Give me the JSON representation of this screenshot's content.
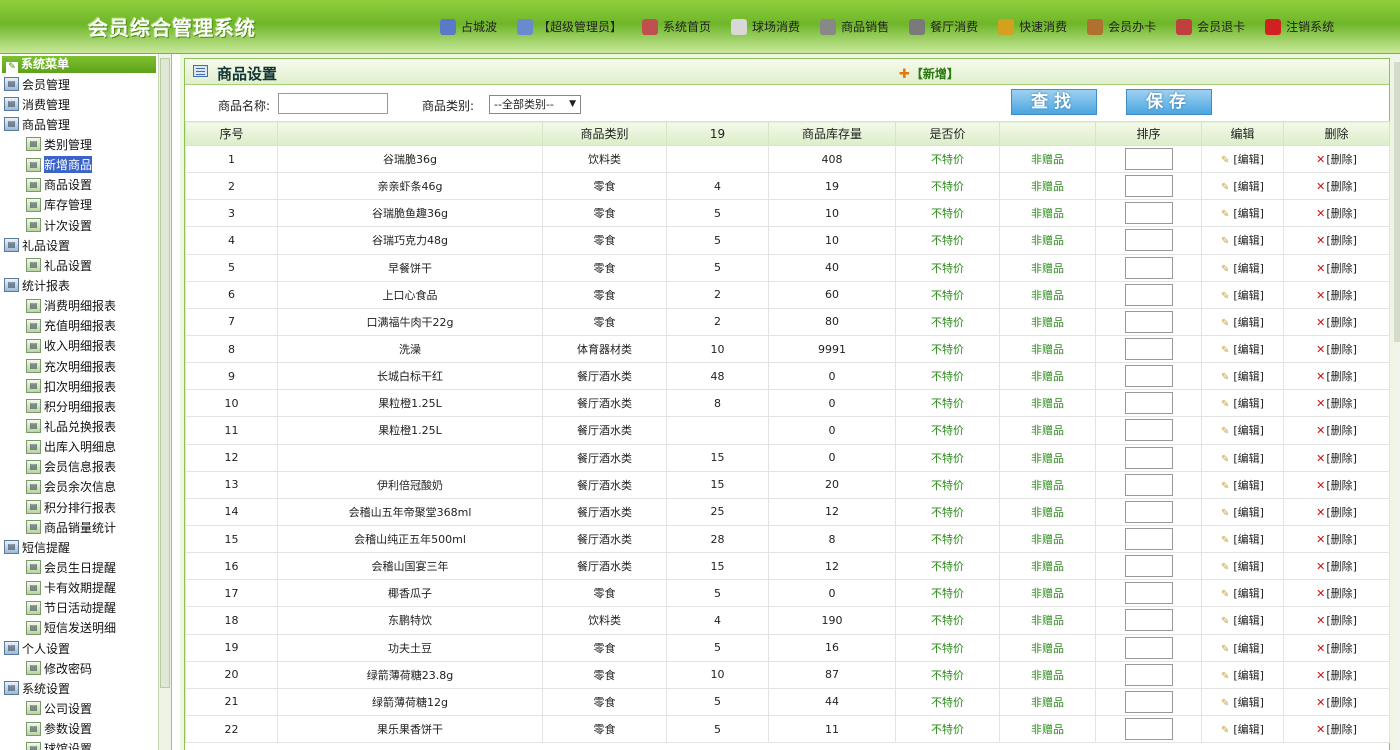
{
  "app": {
    "title": "会员综合管理系统"
  },
  "nav": [
    {
      "label": "占城波",
      "icon": "user-icon",
      "color": "#5a7ac8"
    },
    {
      "label": "【超级管理员】",
      "icon": "users-icon",
      "color": "#6a8ad0"
    },
    {
      "label": "系统首页",
      "icon": "home-icon",
      "color": "#c05050"
    },
    {
      "label": "球场消费",
      "icon": "ball-icon",
      "color": "#d8d8d8"
    },
    {
      "label": "商品销售",
      "icon": "tag-icon",
      "color": "#888888"
    },
    {
      "label": "餐厅消费",
      "icon": "dining-icon",
      "color": "#7a7a7a"
    },
    {
      "label": "快速消费",
      "icon": "lightning-icon",
      "color": "#d4a020"
    },
    {
      "label": "会员办卡",
      "icon": "card-user-icon",
      "color": "#b07030"
    },
    {
      "label": "会员退卡",
      "icon": "return-card-icon",
      "color": "#c04040"
    },
    {
      "label": "注销系统",
      "icon": "logout-icon",
      "color": "#d02020"
    }
  ],
  "sidebar": {
    "title": "系统菜单",
    "items": [
      {
        "label": "会员管理",
        "level": 0
      },
      {
        "label": "消费管理",
        "level": 0
      },
      {
        "label": "商品管理",
        "level": 0
      },
      {
        "label": "类别管理",
        "level": 1
      },
      {
        "label": "新增商品",
        "level": 1,
        "active": true
      },
      {
        "label": "商品设置",
        "level": 1
      },
      {
        "label": "库存管理",
        "level": 1
      },
      {
        "label": "计次设置",
        "level": 1
      },
      {
        "label": "礼品设置",
        "level": 0
      },
      {
        "label": "礼品设置",
        "level": 1
      },
      {
        "label": "统计报表",
        "level": 0
      },
      {
        "label": "消费明细报表",
        "level": 1
      },
      {
        "label": "充值明细报表",
        "level": 1
      },
      {
        "label": "收入明细报表",
        "level": 1
      },
      {
        "label": "充次明细报表",
        "level": 1
      },
      {
        "label": "扣次明细报表",
        "level": 1
      },
      {
        "label": "积分明细报表",
        "level": 1
      },
      {
        "label": "礼品兑换报表",
        "level": 1
      },
      {
        "label": "出库入明细息",
        "level": 1
      },
      {
        "label": "会员信息报表",
        "level": 1
      },
      {
        "label": "会员余次信息",
        "level": 1
      },
      {
        "label": "积分排行报表",
        "level": 1
      },
      {
        "label": "商品销量统计",
        "level": 1
      },
      {
        "label": "短信提醒",
        "level": 0
      },
      {
        "label": "会员生日提醒",
        "level": 1
      },
      {
        "label": "卡有效期提醒",
        "level": 1
      },
      {
        "label": "节日活动提醒",
        "level": 1
      },
      {
        "label": "短信发送明细",
        "level": 1
      },
      {
        "label": "个人设置",
        "level": 0
      },
      {
        "label": "修改密码",
        "level": 1
      },
      {
        "label": "系统设置",
        "level": 0
      },
      {
        "label": "公司设置",
        "level": 1
      },
      {
        "label": "参数设置",
        "level": 1
      },
      {
        "label": "球馆设置",
        "level": 1
      }
    ]
  },
  "panel": {
    "title": "商品设置",
    "add_label": "【新增】",
    "name_label": "商品名称:",
    "name_value": "",
    "category_label": "商品类别:",
    "category_value": "--全部类别--",
    "search_button": "查找",
    "save_button": "保存"
  },
  "table": {
    "columns": [
      "序号",
      "",
      "商品类别",
      "19",
      "商品库存量",
      "是否价",
      "",
      "排序",
      "编辑",
      "删除"
    ],
    "edit_label": "[编辑]",
    "delete_label": "[删除]",
    "rows": [
      {
        "no": "1",
        "name": "谷瑞脆36g",
        "category": "饮料类",
        "price": "",
        "stock": "408",
        "special": "不特价",
        "gift": "非赠品"
      },
      {
        "no": "2",
        "name": "亲亲虾条46g",
        "category": "零食",
        "price": "4",
        "stock": "19",
        "special": "不特价",
        "gift": "非赠品"
      },
      {
        "no": "3",
        "name": "谷瑞脆鱼趣36g",
        "category": "零食",
        "price": "5",
        "stock": "10",
        "special": "不特价",
        "gift": "非赠品"
      },
      {
        "no": "4",
        "name": "谷瑞巧克力48g",
        "category": "零食",
        "price": "5",
        "stock": "10",
        "special": "不特价",
        "gift": "非赠品"
      },
      {
        "no": "5",
        "name": "早餐饼干",
        "category": "零食",
        "price": "5",
        "stock": "40",
        "special": "不特价",
        "gift": "非赠品"
      },
      {
        "no": "6",
        "name": "上口心食品",
        "category": "零食",
        "price": "2",
        "stock": "60",
        "special": "不特价",
        "gift": "非赠品"
      },
      {
        "no": "7",
        "name": "口满福牛肉干22g",
        "category": "零食",
        "price": "2",
        "stock": "80",
        "special": "不特价",
        "gift": "非赠品"
      },
      {
        "no": "8",
        "name": "洗澡",
        "category": "体育器材类",
        "price": "10",
        "stock": "9991",
        "special": "不特价",
        "gift": "非赠品"
      },
      {
        "no": "9",
        "name": "长城白标干红",
        "category": "餐厅酒水类",
        "price": "48",
        "stock": "0",
        "special": "不特价",
        "gift": "非赠品"
      },
      {
        "no": "10",
        "name": "果粒橙1.25L",
        "category": "餐厅酒水类",
        "price": "8",
        "stock": "0",
        "special": "不特价",
        "gift": "非赠品"
      },
      {
        "no": "11",
        "name": "果粒橙1.25L",
        "category": "餐厅酒水类",
        "price": "",
        "stock": "0",
        "special": "不特价",
        "gift": "非赠品"
      },
      {
        "no": "12",
        "name": "",
        "category": "餐厅酒水类",
        "price": "15",
        "stock": "0",
        "special": "不特价",
        "gift": "非赠品"
      },
      {
        "no": "13",
        "name": "伊利倍冠酸奶",
        "category": "餐厅酒水类",
        "price": "15",
        "stock": "20",
        "special": "不特价",
        "gift": "非赠品"
      },
      {
        "no": "14",
        "name": "会稽山五年帝聚堂368ml",
        "category": "餐厅酒水类",
        "price": "25",
        "stock": "12",
        "special": "不特价",
        "gift": "非赠品"
      },
      {
        "no": "15",
        "name": "会稽山纯正五年500ml",
        "category": "餐厅酒水类",
        "price": "28",
        "stock": "8",
        "special": "不特价",
        "gift": "非赠品"
      },
      {
        "no": "16",
        "name": "会稽山国宴三年",
        "category": "餐厅酒水类",
        "price": "15",
        "stock": "12",
        "special": "不特价",
        "gift": "非赠品"
      },
      {
        "no": "17",
        "name": "椰香瓜子",
        "category": "零食",
        "price": "5",
        "stock": "0",
        "special": "不特价",
        "gift": "非赠品"
      },
      {
        "no": "18",
        "name": "东鹏特饮",
        "category": "饮料类",
        "price": "4",
        "stock": "190",
        "special": "不特价",
        "gift": "非赠品"
      },
      {
        "no": "19",
        "name": "功夫土豆",
        "category": "零食",
        "price": "5",
        "stock": "16",
        "special": "不特价",
        "gift": "非赠品"
      },
      {
        "no": "20",
        "name": "绿箭薄荷糖23.8g",
        "category": "零食",
        "price": "10",
        "stock": "87",
        "special": "不特价",
        "gift": "非赠品"
      },
      {
        "no": "21",
        "name": "绿箭薄荷糖12g",
        "category": "零食",
        "price": "5",
        "stock": "44",
        "special": "不特价",
        "gift": "非赠品"
      },
      {
        "no": "22",
        "name": "果乐果香饼干",
        "category": "零食",
        "price": "5",
        "stock": "11",
        "special": "不特价",
        "gift": "非赠品"
      }
    ]
  }
}
